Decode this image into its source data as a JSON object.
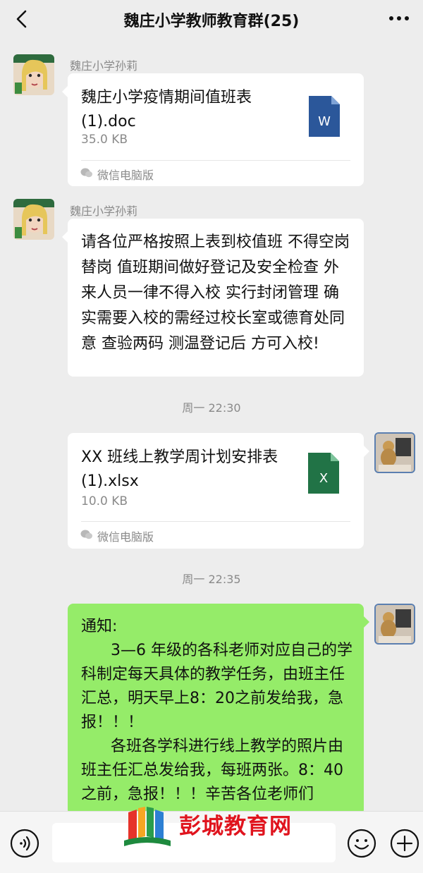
{
  "header": {
    "title": "魏庄小学教师教育群(25)"
  },
  "messages": [
    {
      "sender": "魏庄小学孙莉",
      "file_name": "魏庄小学疫情期间值班表(1).doc",
      "file_size": "35.0 KB",
      "file_type": "word",
      "file_icon_letter": "W",
      "source": "微信电脑版"
    },
    {
      "sender": "魏庄小学孙莉",
      "text": "请各位严格按照上表到校值班 不得空岗替岗 值班期间做好登记及安全检查 外来人员一律不得入校 实行封闭管理  确实需要入校的需经过校长室或德育处同意 查验两码 测温登记后 方可入校!"
    },
    {
      "timestamp": "周一 22:30"
    },
    {
      "file_name": "XX 班线上教学周计划安排表(1).xlsx",
      "file_size": "10.0 KB",
      "file_type": "excel",
      "file_icon_letter": "X",
      "source": "微信电脑版"
    },
    {
      "timestamp": "周一 22:35"
    },
    {
      "text": "通知:\n      3—6 年级的各科老师对应自己的学科制定每天具体的教学任务，由班主任汇总，明天早上8：20之前发给我，急报！！！\n      各班各学科进行线上教学的照片由班主任汇总发给我，每班两张。8：40之前，急报！！！辛苦各位老师们"
    }
  ],
  "watermark": {
    "text": "彭城教育网"
  },
  "colors": {
    "background": "#ededed",
    "bubble_white": "#ffffff",
    "bubble_green": "#95ec69",
    "word_blue": "#2b579a",
    "excel_green": "#217346"
  },
  "icons": [
    "back-icon",
    "more-icon",
    "word-file-icon",
    "excel-file-icon",
    "wechat-pc-icon",
    "voice-icon",
    "emoji-icon",
    "plus-icon"
  ]
}
